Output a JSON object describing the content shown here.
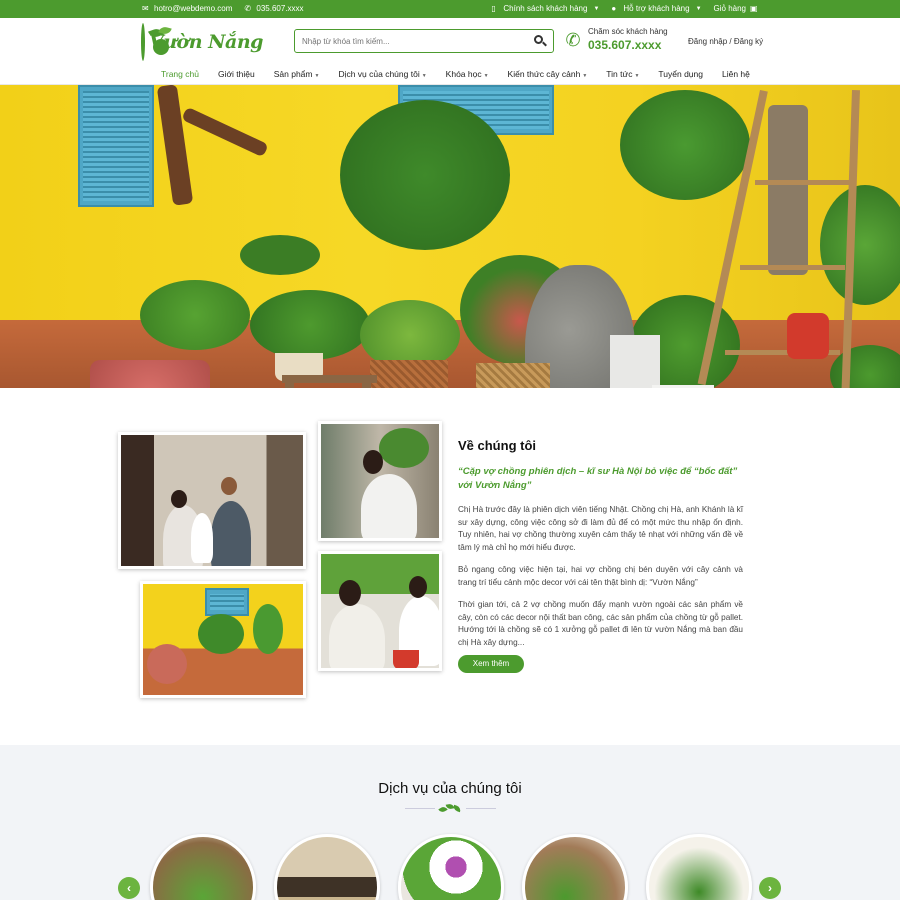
{
  "topbar": {
    "email": "hotro@webdemo.com",
    "phone": "035.607.xxxx",
    "policy": "Chính sách khách hàng",
    "support": "Hỗ trợ khách hàng",
    "cart": "Giỏ hàng"
  },
  "header": {
    "logo_text": "Vườn Nắng",
    "search_placeholder": "Nhập từ khóa tìm kiếm...",
    "care_label": "Chăm sóc khách hàng",
    "care_phone": "035.607.xxxx",
    "login": "Đăng nhập / Đăng ký"
  },
  "nav": {
    "items": [
      {
        "label": "Trang chủ"
      },
      {
        "label": "Giới thiệu"
      },
      {
        "label": "Sản phẩm"
      },
      {
        "label": "Dịch vụ của chúng tôi"
      },
      {
        "label": "Khóa học"
      },
      {
        "label": "Kiến thức cây cảnh"
      },
      {
        "label": "Tin tức"
      },
      {
        "label": "Tuyển dụng"
      },
      {
        "label": "Liên hệ"
      }
    ]
  },
  "hero": {
    "slide_count": 3,
    "active_slide": 1
  },
  "about": {
    "title": "Về chúng tôi",
    "quote": "“Cặp vợ chồng phiên dịch – kĩ sư Hà Nội bỏ việc để “bốc đất” với Vườn Nắng”",
    "p1": "Chị Hà trước đây là phiên dịch viên tiếng Nhật. Chồng chị Hà, anh Khánh là kĩ sư xây dựng, công việc công sở đi làm đủ để có một mức thu nhập ổn định. Tuy nhiên, hai vợ chồng thường xuyên cảm thấy tẻ nhạt với những vấn đề về tâm lý mà chỉ họ mới hiểu được.",
    "p2": "Bỏ ngang công việc hiện tại, hai vợ chồng chị bén duyên với cây cảnh và trang trí tiểu cảnh mộc decor với cái tên thật bình dị: “Vườn Nắng”",
    "p3": "Thời gian tới, cả 2 vợ chồng muốn đẩy mạnh vườn ngoài các sản phẩm về cây, còn có các decor nội thất ban công, các sản phẩm của chồng từ gỗ pallet. Hướng tới là chồng sẽ có 1 xưởng gỗ pallet đi lên từ vườn Nắng mà ban đầu chị Hà xây dựng...",
    "button": "Xem thêm"
  },
  "services": {
    "title": "Dịch vụ của chúng tôi",
    "prev_icon": "‹",
    "next_icon": "›"
  },
  "colors": {
    "brand_green": "#4c9b2e",
    "accent_green": "#6cb43f",
    "wall_yellow": "#f3d21c"
  }
}
